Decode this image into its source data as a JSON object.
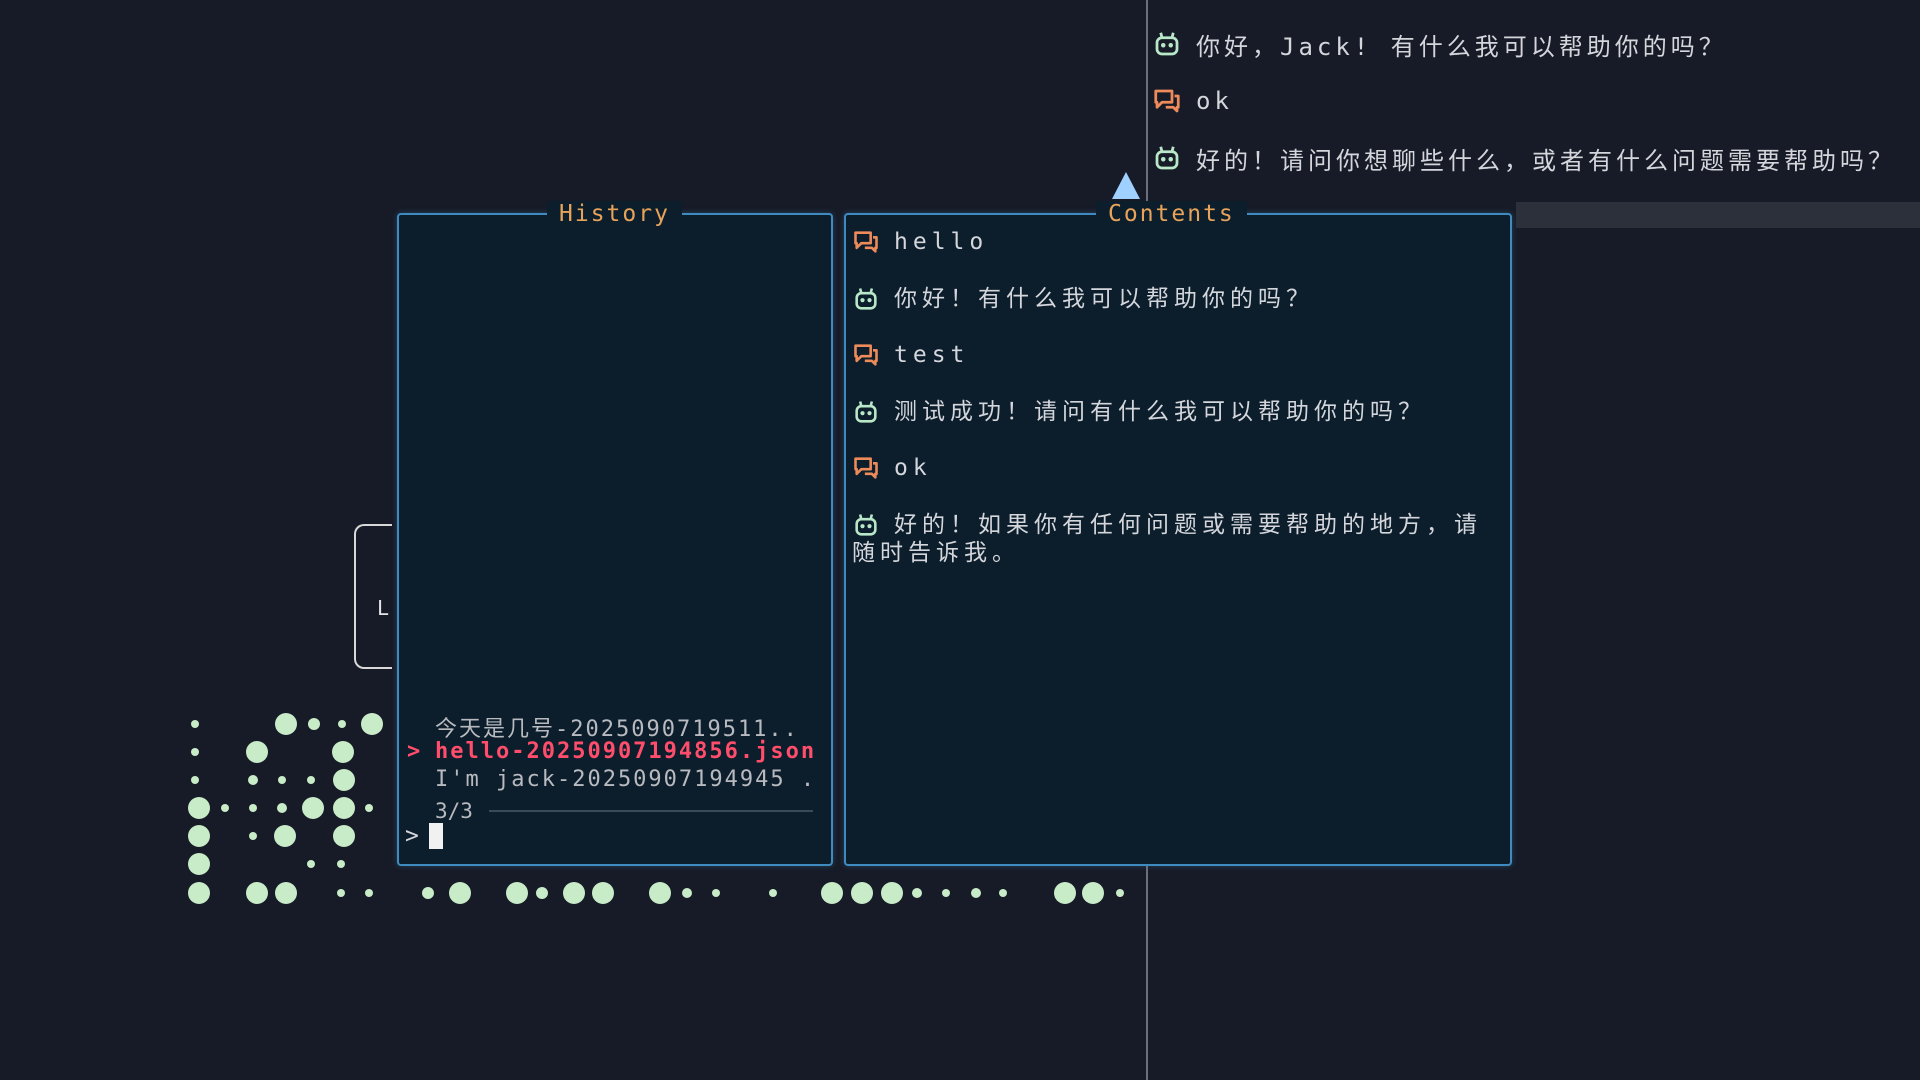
{
  "colors": {
    "background": "#171b27",
    "panel_bg": "#0c1e2c",
    "panel_border": "#3f8bbf",
    "title": "#e8a35a",
    "user_icon": "#ee8b5a",
    "bot_icon": "#b9e8c8",
    "selected": "#ff4d6b",
    "dot": "#c8ebc8"
  },
  "icons": {
    "user": "chat-bubbles-icon",
    "bot": "robot-icon"
  },
  "background_chat": [
    {
      "role": "bot",
      "text": "你好，Jack! 有什么我可以帮助你的吗？"
    },
    {
      "role": "user",
      "text": "ok"
    },
    {
      "role": "bot",
      "text": "好的！请问你想聊些什么，或者有什么问题需要帮助吗？"
    }
  ],
  "history": {
    "title": "History",
    "items": [
      {
        "label": "今天是几号-2025090719511..",
        "selected": false
      },
      {
        "label": "hello-20250907194856.json",
        "selected": true
      },
      {
        "label": "I'm jack-20250907194945 ...",
        "selected": false
      }
    ],
    "selected_marker": ">",
    "counter": "3/3",
    "prompt_symbol": ">",
    "query": ""
  },
  "contents": {
    "title": "Contents",
    "messages": [
      {
        "role": "user",
        "text": "hello"
      },
      {
        "role": "bot",
        "text": "你好！有什么我可以帮助你的吗？"
      },
      {
        "role": "user",
        "text": "test"
      },
      {
        "role": "bot",
        "text": "测试成功！请问有什么我可以帮助你的吗？"
      },
      {
        "role": "user",
        "text": "ok"
      },
      {
        "role": "bot",
        "text": "好的！如果你有任何问题或需要帮助的地方，请随时告诉我。"
      }
    ]
  },
  "background_panel_letter": "L"
}
